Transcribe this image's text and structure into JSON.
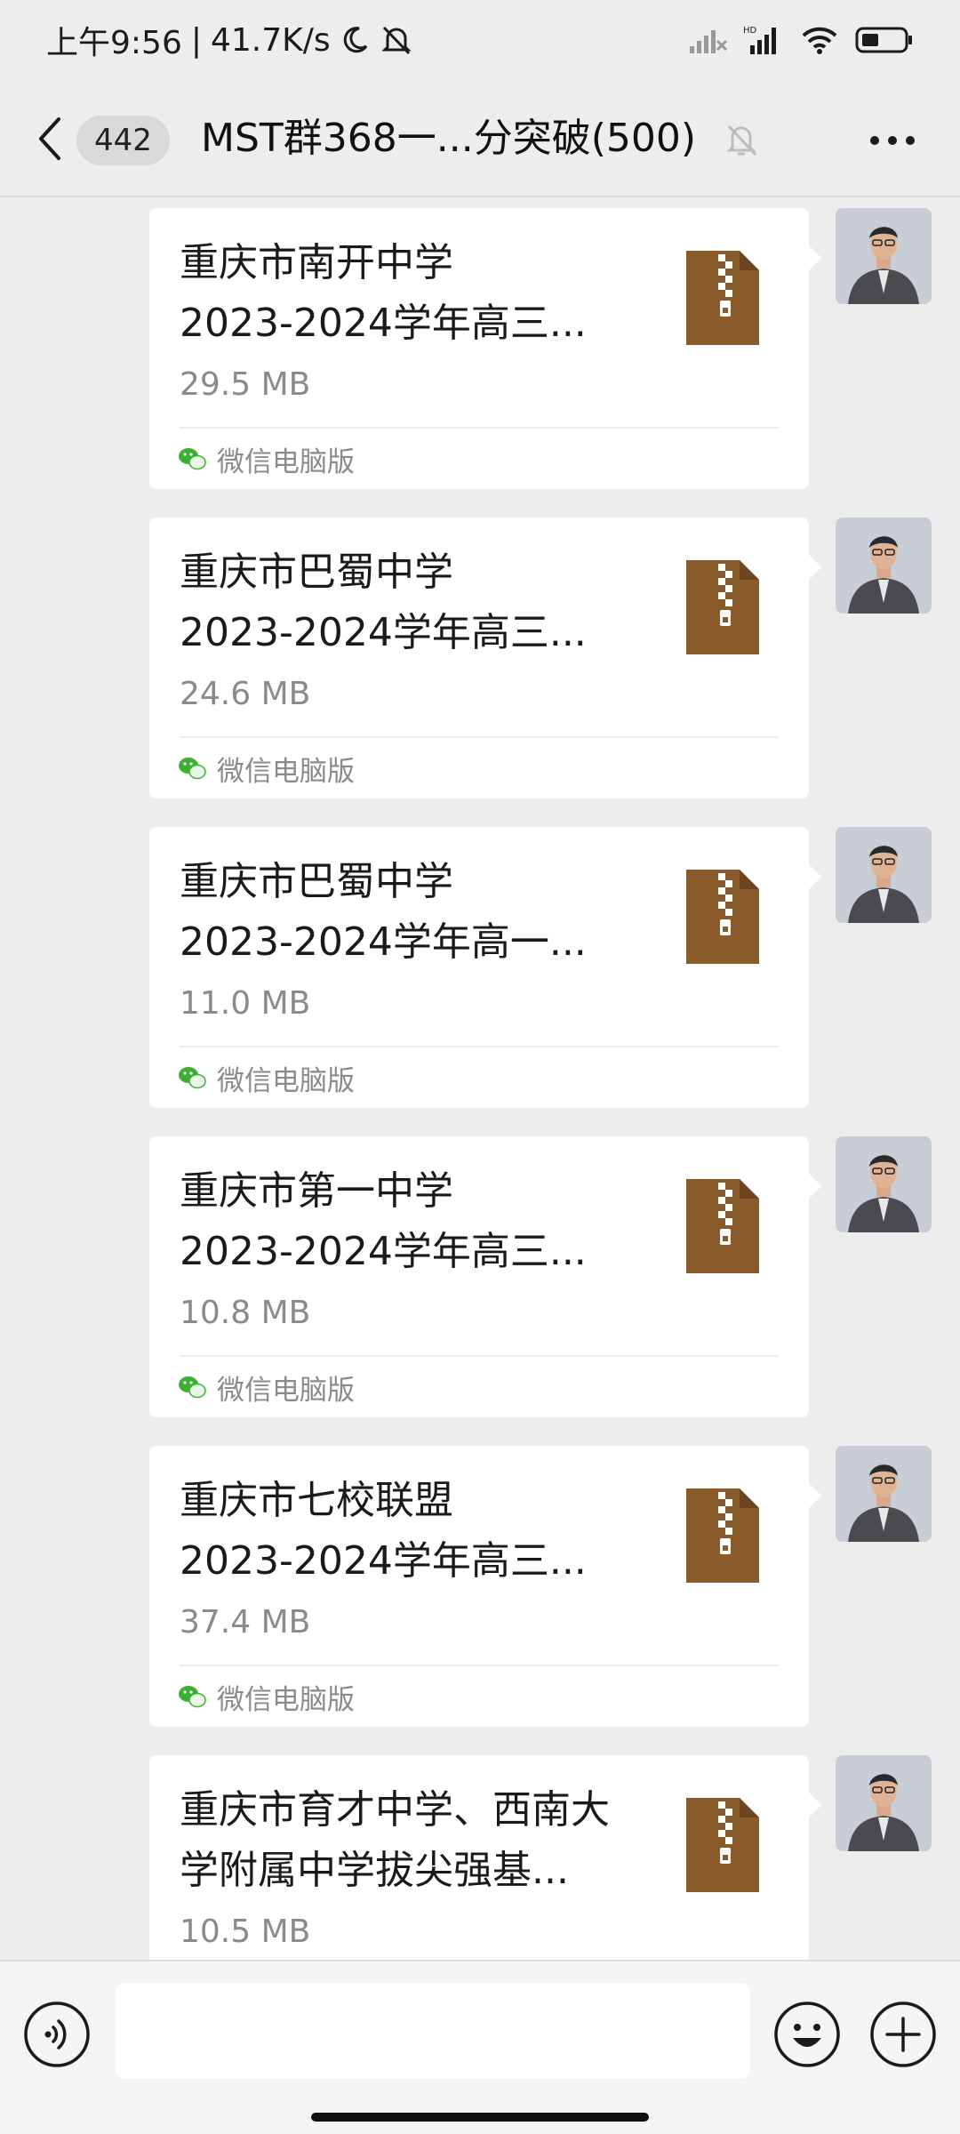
{
  "status_bar": {
    "time": "上午9:56",
    "separator": "|",
    "network_speed": "41.7K/s",
    "icons": [
      "moon-icon",
      "mute-bell-icon",
      "signal-x-icon",
      "hd-signal-icon",
      "wifi-icon",
      "battery-icon"
    ],
    "hd_label": "HD"
  },
  "header": {
    "unread_count": "442",
    "title": "MST群368一...分突破(500)",
    "icons": [
      "back-chevron-icon",
      "mute-bell-icon",
      "more-dots-icon"
    ]
  },
  "messages": [
    {
      "file_name": "重庆市南开中学\n2023-2024学年高三...",
      "file_size": "29.5 MB",
      "source": "微信电脑版"
    },
    {
      "file_name": "重庆市巴蜀中学\n2023-2024学年高三...",
      "file_size": "24.6 MB",
      "source": "微信电脑版"
    },
    {
      "file_name": "重庆市巴蜀中学\n2023-2024学年高一...",
      "file_size": "11.0 MB",
      "source": "微信电脑版"
    },
    {
      "file_name": "重庆市第一中学\n2023-2024学年高三...",
      "file_size": "10.8 MB",
      "source": "微信电脑版"
    },
    {
      "file_name": "重庆市七校联盟\n2023-2024学年高三...",
      "file_size": "37.4 MB",
      "source": "微信电脑版"
    },
    {
      "file_name": "重庆市育才中学、西南大\n学附属中学拔尖强基...",
      "file_size": "10.5 MB",
      "source": ""
    }
  ],
  "colors": {
    "background": "#ededed",
    "bubble": "#ffffff",
    "zip_brown": "#8b5a2b",
    "wechat_green": "#3cb034",
    "secondary_text": "#8a8a8a"
  },
  "input_bar": {
    "icons": [
      "voice-icon",
      "emoji-icon",
      "plus-icon"
    ]
  }
}
